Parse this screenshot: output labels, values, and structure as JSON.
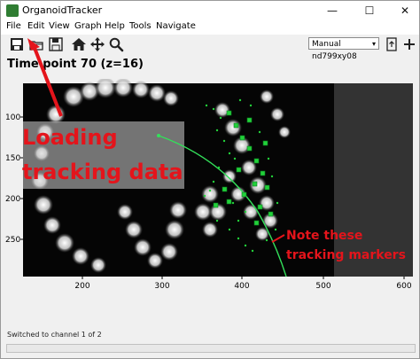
{
  "window": {
    "title": "OrganoidTracker",
    "minimize_glyph": "—",
    "maximize_glyph": "☐",
    "close_glyph": "✕"
  },
  "menu": [
    "File",
    "Edit",
    "View",
    "Graph",
    "Help",
    "Tools",
    "Navigate"
  ],
  "toolbar": {
    "icons": [
      "new-project-icon",
      "load-tracking-icon",
      "save-icon",
      "home-icon",
      "pan-icon",
      "zoom-icon"
    ],
    "dataset_selected": "Manual nd799xy08",
    "right_icons": [
      "export-icon",
      "add-icon"
    ]
  },
  "view": {
    "heading": "Time point 70   (z=16)",
    "y_ticks": [
      "100",
      "150",
      "200",
      "250"
    ],
    "x_ticks": [
      "200",
      "300",
      "400",
      "500",
      "600"
    ]
  },
  "annotations": {
    "loading_label": "Loading\ntracking data",
    "markers_label": "Note these\ntracking markers"
  },
  "statusbar": {
    "message": "Switched to channel 1 of 2"
  },
  "colors": {
    "annotation_red": "#e4141b",
    "marker_green": "#22d13a",
    "track_green": "#33e05a"
  }
}
